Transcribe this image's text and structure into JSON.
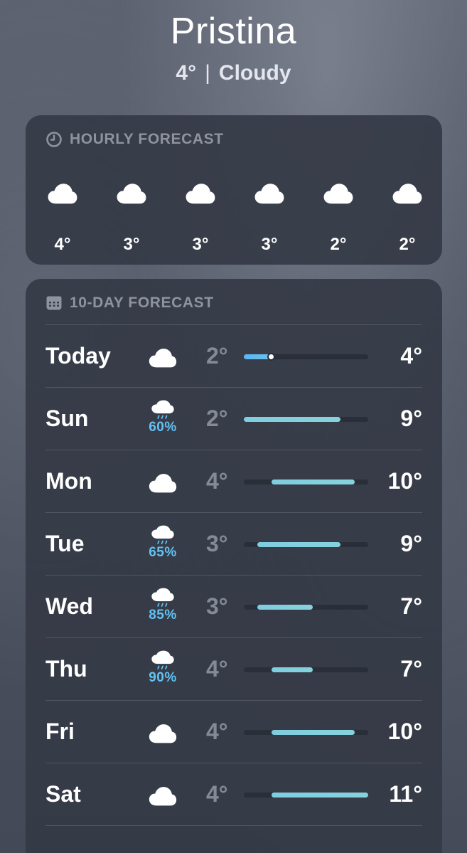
{
  "location": {
    "city": "Pristina",
    "current_temp": "4°",
    "separator": "|",
    "condition": "Cloudy"
  },
  "hourly": {
    "title": "HOURLY FORECAST",
    "icon": "clock-icon",
    "items": [
      {
        "icon": "cloud-icon",
        "temp": "4°"
      },
      {
        "icon": "cloud-icon",
        "temp": "3°"
      },
      {
        "icon": "cloud-icon",
        "temp": "3°"
      },
      {
        "icon": "cloud-icon",
        "temp": "3°"
      },
      {
        "icon": "cloud-icon",
        "temp": "2°"
      },
      {
        "icon": "cloud-icon",
        "temp": "2°"
      }
    ]
  },
  "daily": {
    "title": "10-DAY FORECAST",
    "icon": "calendar-icon",
    "range_colors": {
      "cool": "#7fcde0",
      "cold": "#5cb6f0",
      "track": "#2a2e38"
    },
    "days": [
      {
        "day": "Today",
        "icon": "cloud-icon",
        "pop": "",
        "low": "2°",
        "high": "4°",
        "low_value": 2,
        "high_value": 4,
        "current_value": 4
      },
      {
        "day": "Sun",
        "icon": "cloud-rain-icon",
        "pop": "60%",
        "low": "2°",
        "high": "9°",
        "low_value": 2,
        "high_value": 9
      },
      {
        "day": "Mon",
        "icon": "cloud-icon",
        "pop": "",
        "low": "4°",
        "high": "10°",
        "low_value": 4,
        "high_value": 10
      },
      {
        "day": "Tue",
        "icon": "cloud-rain-icon",
        "pop": "65%",
        "low": "3°",
        "high": "9°",
        "low_value": 3,
        "high_value": 9
      },
      {
        "day": "Wed",
        "icon": "cloud-rain-icon",
        "pop": "85%",
        "low": "3°",
        "high": "7°",
        "low_value": 3,
        "high_value": 7
      },
      {
        "day": "Thu",
        "icon": "cloud-rain-icon",
        "pop": "90%",
        "low": "4°",
        "high": "7°",
        "low_value": 4,
        "high_value": 7
      },
      {
        "day": "Fri",
        "icon": "cloud-icon",
        "pop": "",
        "low": "4°",
        "high": "10°",
        "low_value": 4,
        "high_value": 10
      },
      {
        "day": "Sat",
        "icon": "cloud-icon",
        "pop": "",
        "low": "4°",
        "high": "11°",
        "low_value": 4,
        "high_value": 11
      }
    ]
  }
}
